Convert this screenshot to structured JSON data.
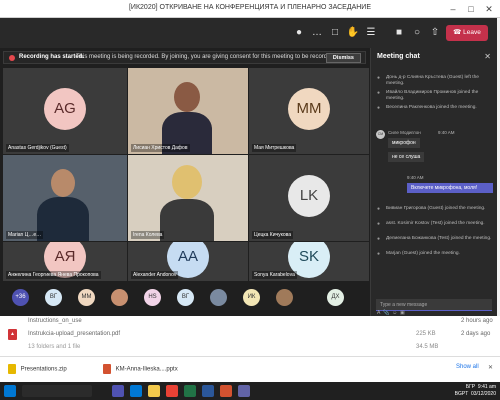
{
  "window": {
    "title": "[ИК2020] ОТКРИВАНЕ НА КОНФЕРЕНЦИЯТА И ПЛЕНАРНО ЗАСЕДАНИЕ"
  },
  "toolbar": {
    "leave_label": "Leave",
    "leave_color": "#c4314b"
  },
  "banner": {
    "strong": "Recording has started.",
    "text": "This meeting is being recorded. By joining, you are giving consent for this meeting to be recorded. ...",
    "dismiss": "Dismiss"
  },
  "tiles": [
    {
      "initials": "AG",
      "name": "Anastas Gerdjikov (Guest)",
      "avatar_bg": "#f2c6c2",
      "avatar_fg": "#5a2a2a"
    },
    {
      "initials": "",
      "name": "Лисиан Христов Дафов",
      "avatar_bg": "",
      "avatar_fg": ""
    },
    {
      "initials": "MM",
      "name": "Мая Митрешкова",
      "avatar_bg": "#f0d8c0",
      "avatar_fg": "#5a3a1a"
    },
    {
      "initials": "",
      "name": "Marian Ц…е…",
      "avatar_bg": "",
      "avatar_fg": ""
    },
    {
      "initials": "",
      "name": "Irena Колева",
      "avatar_bg": "",
      "avatar_fg": ""
    },
    {
      "initials": "LK",
      "name": "Цецка Кичукова",
      "avatar_bg": "#e8e8e8",
      "avatar_fg": "#444"
    },
    {
      "initials": "АЯ",
      "name": "Анжелина Георгиева Янева Прокопова",
      "avatar_bg": "#f2c6c2",
      "avatar_fg": "#5a2a2a"
    },
    {
      "initials": "AA",
      "name": "Alexander Andonov",
      "avatar_bg": "#c6dcf2",
      "avatar_fg": "#1f3a5a"
    },
    {
      "initials": "SK",
      "name": "Sonya Karabelova",
      "avatar_bg": "#d9eef6",
      "avatar_fg": "#1f4a5a"
    }
  ],
  "strip": [
    {
      "label": "+36",
      "bg": "#4f52b2",
      "fg": "#fff"
    },
    {
      "label": "ВГ",
      "bg": "#d6e8f5",
      "fg": "#333"
    },
    {
      "label": "MM",
      "bg": "#f0d8c0",
      "fg": "#333"
    },
    {
      "label": "",
      "bg": "#c89070",
      "fg": "#333"
    },
    {
      "label": "HS",
      "bg": "#f2d4e8",
      "fg": "#333"
    },
    {
      "label": "ВГ",
      "bg": "#d6e8f5",
      "fg": "#333"
    },
    {
      "label": "",
      "bg": "#7a8aa0",
      "fg": "#333"
    },
    {
      "label": "ИК",
      "bg": "#f3e6b5",
      "fg": "#333"
    },
    {
      "label": "",
      "bg": "#a07a5a",
      "fg": "#333"
    },
    {
      "label": "ДХ",
      "bg": "#e3efe4",
      "fg": "#333"
    }
  ],
  "chat": {
    "title": "Meeting chat",
    "events_top": [
      "Донь д-р Слияна Кръстева (Guest) left the meeting.",
      "Ивайло Владимиров Проминов joined the meeting.",
      "Веселина Ракленкова joined the meeting."
    ],
    "incoming": {
      "initials": "СМ",
      "sender": "Силе Модиглон",
      "time": "9:40 AM",
      "lines": [
        "микрофон",
        "не се слуша"
      ]
    },
    "outgoing": {
      "time": "9:40 AM",
      "text": "Включете микрофона, моля!"
    },
    "events_bottom": [
      "Бивиан Григорова (Guest) joined the meeting.",
      "asst. Kosimir Kostov (Test) joined the meeting.",
      "Делиелана Божанкова (Test) joined the meeting.",
      "Marjan (Guest) joined the meeting."
    ],
    "compose_placeholder": "Type a new message"
  },
  "explorer": {
    "rows": [
      {
        "name": "Instructions_on_use",
        "size": "",
        "date": "2 hours ago"
      },
      {
        "name": "Instrukcia-upload_presentation.pdf",
        "size": "225 KB",
        "date": "2 days ago"
      },
      {
        "name": "13 folders and 1 file",
        "size": "34.5 MB",
        "date": ""
      }
    ]
  },
  "downloads": {
    "items": [
      "Presentations.zip",
      "KM-Anna-Ilieska....pptx"
    ],
    "show_all": "Show all"
  },
  "taskbar": {
    "lang": "БГР",
    "lang2": "BGPT",
    "time": "9:41 am",
    "date": "03/12/2020"
  }
}
